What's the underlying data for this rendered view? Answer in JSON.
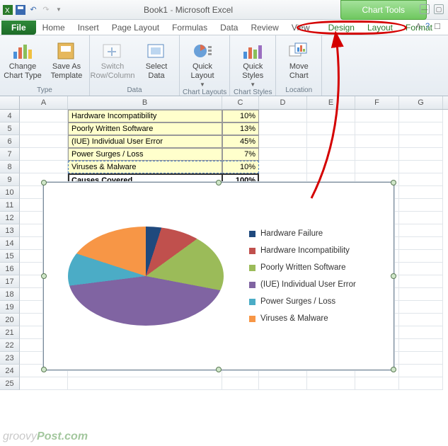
{
  "titlebar": {
    "doc_name": "Book1",
    "app_name": "Microsoft Excel",
    "context_tab_group": "Chart Tools"
  },
  "tabs": {
    "file": "File",
    "items": [
      "Home",
      "Insert",
      "Page Layout",
      "Formulas",
      "Data",
      "Review",
      "View"
    ],
    "context_items": [
      "Design",
      "Layout",
      "Format"
    ]
  },
  "ribbon": {
    "type": {
      "label": "Type",
      "change_chart_type": "Change Chart Type",
      "save_as_template": "Save As Template"
    },
    "data": {
      "label": "Data",
      "switch": "Switch Row/Column",
      "select": "Select Data"
    },
    "chart_layouts": {
      "label": "Chart Layouts",
      "quick_layout": "Quick Layout"
    },
    "chart_styles": {
      "label": "Chart Styles",
      "quick_styles": "Quick Styles"
    },
    "location": {
      "label": "Location",
      "move_chart": "Move Chart"
    }
  },
  "columns": [
    "A",
    "B",
    "C",
    "D",
    "E",
    "F",
    "G"
  ],
  "row_nums": [
    4,
    5,
    6,
    7,
    8,
    9,
    10,
    11,
    12,
    13,
    14,
    15,
    16,
    17,
    18,
    19,
    20,
    21,
    22,
    23,
    24,
    25
  ],
  "table": {
    "rows": [
      {
        "b": "Hardware Incompatibility",
        "c": "10%"
      },
      {
        "b": "Poorly Written Software",
        "c": "13%"
      },
      {
        "b": "(IUE) Individual User Error",
        "c": "45%"
      },
      {
        "b": "Power Surges / Loss",
        "c": "7%"
      },
      {
        "b": "Viruses & Malware",
        "c": "10%"
      }
    ],
    "total": {
      "b": "Causes Covered",
      "c": "100%"
    }
  },
  "chart_data": {
    "type": "pie",
    "title": "",
    "series": [
      {
        "name": "Hardware Failure",
        "value": 5,
        "color": "#1f497d"
      },
      {
        "name": "Hardware Incompatibility",
        "value": 10,
        "color": "#c0504d"
      },
      {
        "name": "Poorly Written Software",
        "value": 13,
        "color": "#9bbb59"
      },
      {
        "name": "(IUE) Individual User Error",
        "value": 45,
        "color": "#8064a2"
      },
      {
        "name": "Power Surges / Loss",
        "value": 7,
        "color": "#4bacc6"
      },
      {
        "name": "Viruses & Malware",
        "value": 20,
        "color": "#f79646"
      }
    ],
    "legend_position": "right"
  },
  "watermark": {
    "a": "groovy",
    "b": "Post.com"
  }
}
